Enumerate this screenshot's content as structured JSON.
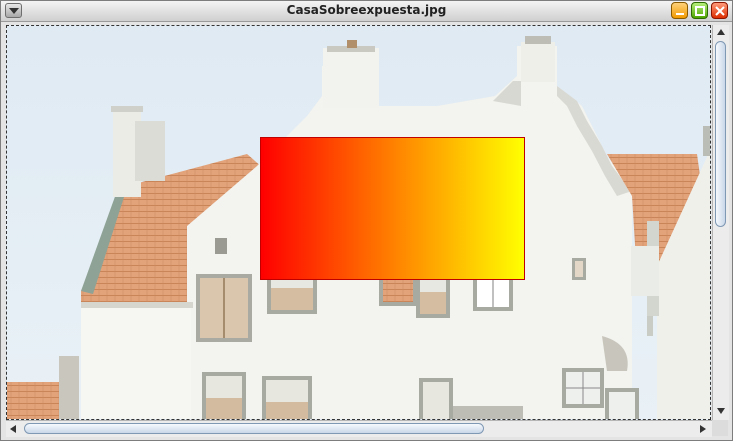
{
  "window": {
    "title": "CasaSobreexpuesta.jpg"
  },
  "titlebar_buttons": {
    "menu_icon": "chevron-down-icon",
    "minimize_icon": "minimize-icon",
    "maximize_icon": "maximize-icon",
    "close_icon": "close-icon"
  },
  "canvas": {
    "image_content": "overexposed photo of white stepped-gable house with orange tiled roofs",
    "overlay": {
      "type": "linear-gradient rectangle",
      "colors": [
        "#ff0000",
        "#ff8000",
        "#ffff00"
      ],
      "border_color": "#c00000"
    }
  },
  "colors": {
    "sky": "#e3eef6",
    "wall": "#f3f3f0",
    "roof": "#dd9a70",
    "stone": "#a2a9a0"
  }
}
